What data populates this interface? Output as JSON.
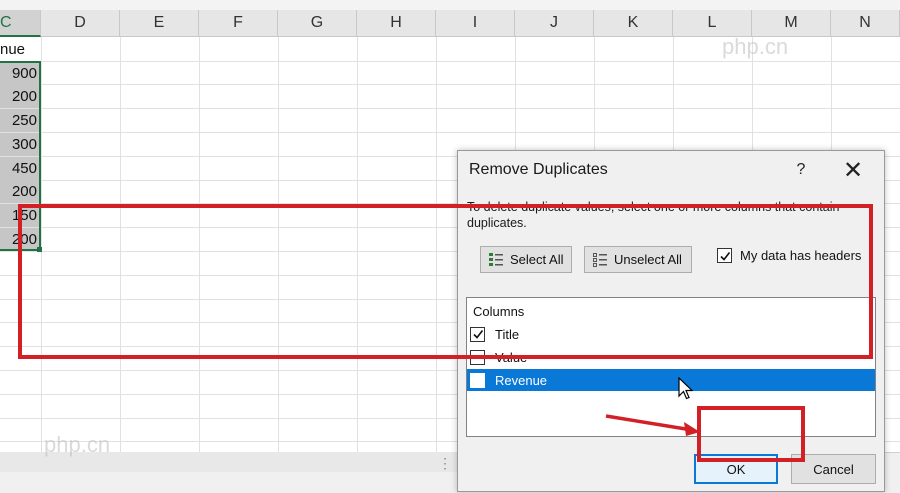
{
  "sheet": {
    "columns": [
      "C",
      "D",
      "E",
      "F",
      "G",
      "H",
      "I",
      "J",
      "K",
      "L",
      "M",
      "N"
    ],
    "header_cell": "nue",
    "values": [
      "900",
      "200",
      "250",
      "300",
      "450",
      "200",
      "150",
      "200"
    ]
  },
  "watermarks": [
    "php.cn",
    "php.cn"
  ],
  "dialog": {
    "title": "Remove Duplicates",
    "help": "?",
    "close": "✕",
    "description": "To delete duplicate values, select one or more columns that contain duplicates.",
    "select_all": "Select All",
    "unselect_all": "Unselect All",
    "headers_label": "My data has headers",
    "headers_checked": true,
    "columns_header": "Columns",
    "columns": [
      {
        "label": "Title",
        "checked": true
      },
      {
        "label": "Value",
        "checked": false
      },
      {
        "label": "Revenue",
        "checked": false,
        "selected": true
      }
    ],
    "ok": "OK",
    "cancel": "Cancel"
  },
  "colors": {
    "accent": "#0a78d7",
    "annotation": "#d32027",
    "excel_green": "#217346"
  }
}
